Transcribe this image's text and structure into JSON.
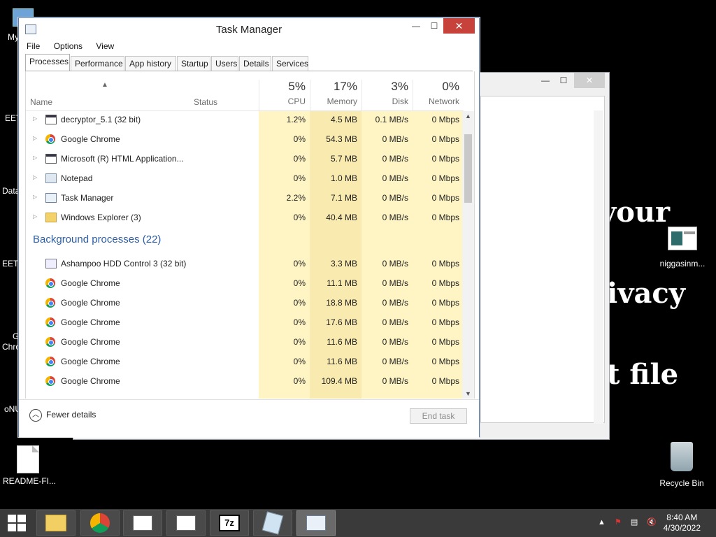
{
  "desktop": {
    "icons": [
      {
        "label": "My C",
        "name": "desktop-icon-my-computer"
      },
      {
        "label": "EET",
        "name": "desktop-icon-eet"
      },
      {
        "label": "Data",
        "name": "desktop-icon-data"
      },
      {
        "label": "EETK",
        "name": "desktop-icon-eetk"
      },
      {
        "label": "G",
        "name": "desktop-icon-g"
      },
      {
        "label": "Chro",
        "name": "desktop-icon-chrome"
      },
      {
        "label": "oNU",
        "name": "desktop-icon-onu"
      },
      {
        "label": "README-FI...",
        "name": "desktop-icon-readme"
      },
      {
        "label": "niggasinm...",
        "name": "desktop-icon-niggasinm"
      },
      {
        "label": "Recycle Bin",
        "name": "desktop-icon-recycle-bin"
      }
    ],
    "background_text": [
      "your",
      "ivacy",
      "t file"
    ]
  },
  "task_manager": {
    "title": "Task Manager",
    "menu": [
      "File",
      "Options",
      "View"
    ],
    "tabs": [
      "Processes",
      "Performance",
      "App history",
      "Startup",
      "Users",
      "Details",
      "Services"
    ],
    "active_tab": "Processes",
    "columns": {
      "name": "Name",
      "status": "Status",
      "cpu": {
        "pct": "5%",
        "label": "CPU"
      },
      "memory": {
        "pct": "17%",
        "label": "Memory"
      },
      "disk": {
        "pct": "3%",
        "label": "Disk"
      },
      "network": {
        "pct": "0%",
        "label": "Network"
      }
    },
    "apps": [
      {
        "name": "decryptor_5.1 (32 bit)",
        "icon": "window-icon",
        "cpu": "1.2%",
        "memory": "4.5 MB",
        "disk": "0.1 MB/s",
        "network": "0 Mbps"
      },
      {
        "name": "Google Chrome",
        "icon": "chrome-icon",
        "cpu": "0%",
        "memory": "54.3 MB",
        "disk": "0 MB/s",
        "network": "0 Mbps"
      },
      {
        "name": "Microsoft (R) HTML Application...",
        "icon": "window-icon",
        "cpu": "0%",
        "memory": "5.7 MB",
        "disk": "0 MB/s",
        "network": "0 Mbps"
      },
      {
        "name": "Notepad",
        "icon": "notepad-icon",
        "cpu": "0%",
        "memory": "1.0 MB",
        "disk": "0 MB/s",
        "network": "0 Mbps"
      },
      {
        "name": "Task Manager",
        "icon": "task-manager-icon",
        "cpu": "2.2%",
        "memory": "7.1 MB",
        "disk": "0 MB/s",
        "network": "0 Mbps"
      },
      {
        "name": "Windows Explorer (3)",
        "icon": "folder-icon",
        "cpu": "0%",
        "memory": "40.4 MB",
        "disk": "0 MB/s",
        "network": "0 Mbps"
      }
    ],
    "background_group": "Background processes (22)",
    "background": [
      {
        "name": "Ashampoo HDD Control 3 (32 bit)",
        "icon": "app-icon",
        "cpu": "0%",
        "memory": "3.3 MB",
        "disk": "0 MB/s",
        "network": "0 Mbps"
      },
      {
        "name": "Google Chrome",
        "icon": "chrome-icon",
        "cpu": "0%",
        "memory": "11.1 MB",
        "disk": "0 MB/s",
        "network": "0 Mbps"
      },
      {
        "name": "Google Chrome",
        "icon": "chrome-icon",
        "cpu": "0%",
        "memory": "18.8 MB",
        "disk": "0 MB/s",
        "network": "0 Mbps"
      },
      {
        "name": "Google Chrome",
        "icon": "chrome-icon",
        "cpu": "0%",
        "memory": "17.6 MB",
        "disk": "0 MB/s",
        "network": "0 Mbps"
      },
      {
        "name": "Google Chrome",
        "icon": "chrome-icon",
        "cpu": "0%",
        "memory": "11.6 MB",
        "disk": "0 MB/s",
        "network": "0 Mbps"
      },
      {
        "name": "Google Chrome",
        "icon": "chrome-icon",
        "cpu": "0%",
        "memory": "11.6 MB",
        "disk": "0 MB/s",
        "network": "0 Mbps"
      },
      {
        "name": "Google Chrome",
        "icon": "chrome-icon",
        "cpu": "0%",
        "memory": "109.4 MB",
        "disk": "0 MB/s",
        "network": "0 Mbps"
      }
    ],
    "footer": {
      "fewer_details": "Fewer details",
      "end_task": "End task"
    }
  },
  "taskbar": {
    "buttons": [
      "start-icon",
      "file-explorer-icon",
      "chrome-icon",
      "app-window-icon",
      "app-window-icon",
      "7zip-icon",
      "notepad-icon",
      "task-manager-icon"
    ],
    "time": "8:40 AM",
    "date": "4/30/2022"
  },
  "colors": {
    "cpu_shade": "#fff4c4",
    "memory_shade": "#f9eab0",
    "accent_blue": "#2b5ea8",
    "close_red": "#c7423a"
  }
}
